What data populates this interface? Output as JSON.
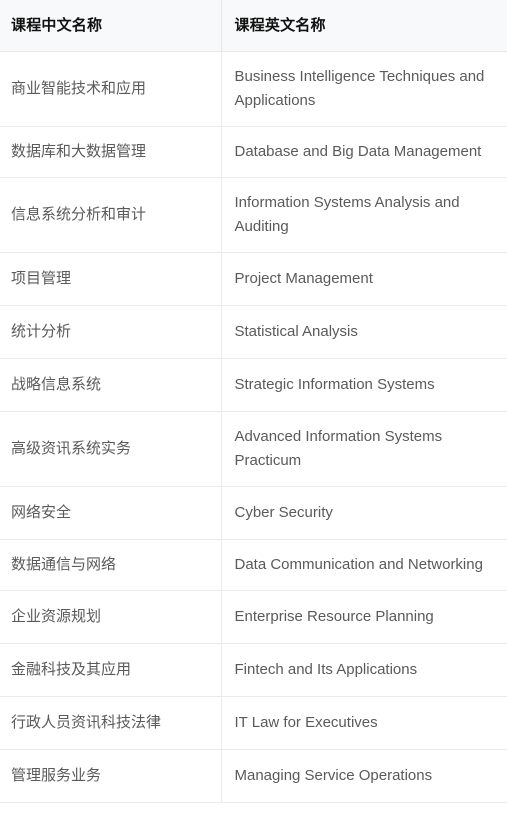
{
  "table": {
    "columns": [
      {
        "key": "cn",
        "label": "课程中文名称"
      },
      {
        "key": "en",
        "label": "课程英文名称"
      }
    ],
    "rows": [
      {
        "cn": "商业智能技术和应用",
        "en": "Business Intelligence Techniques and Applications"
      },
      {
        "cn": "数据库和大数据管理",
        "en": "Database and Big Data Management"
      },
      {
        "cn": "信息系统分析和审计",
        "en": "Information Systems Analysis and Auditing"
      },
      {
        "cn": "项目管理",
        "en": "Project Management"
      },
      {
        "cn": "统计分析",
        "en": "Statistical Analysis"
      },
      {
        "cn": "战略信息系统",
        "en": "Strategic Information Systems"
      },
      {
        "cn": "高级资讯系统实务",
        "en": "Advanced Information Systems Practicum"
      },
      {
        "cn": "网络安全",
        "en": "Cyber Security"
      },
      {
        "cn": "数据通信与网络",
        "en": "Data Communication and Networking"
      },
      {
        "cn": "企业资源规划",
        "en": "Enterprise Resource Planning"
      },
      {
        "cn": "金融科技及其应用",
        "en": "Fintech and Its Applications"
      },
      {
        "cn": "行政人员资讯科技法律",
        "en": "IT Law for Executives"
      },
      {
        "cn": "管理服务业务",
        "en": "Managing Service Operations"
      }
    ]
  },
  "style": {
    "header_background": "#f8f9fa",
    "header_text_color": "#111111",
    "body_text_color": "#5a5a5a",
    "border_color": "#ebebeb",
    "page_background": "#ffffff"
  }
}
